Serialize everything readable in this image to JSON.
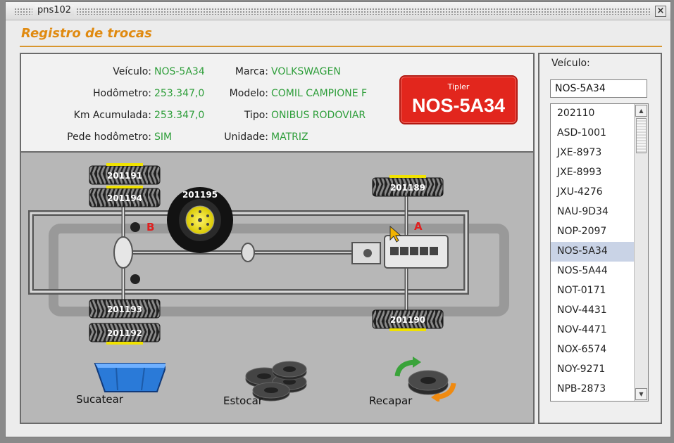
{
  "window": {
    "title": "pns102"
  },
  "section": {
    "title": "Registro de trocas"
  },
  "vehicle_info": {
    "left": [
      {
        "label": "Veículo:",
        "value": "NOS-5A34"
      },
      {
        "label": "Hodômetro:",
        "value": "253.347,0"
      },
      {
        "label": "Km Acumulada:",
        "value": "253.347,0"
      },
      {
        "label": "Pede hodômetro:",
        "value": "SIM"
      }
    ],
    "right": [
      {
        "label": "Marca:",
        "value": "VOLKSWAGEN"
      },
      {
        "label": "Modelo:",
        "value": "COMIL CAMPIONE F"
      },
      {
        "label": "Tipo:",
        "value": "ONIBUS RODOVIAR"
      },
      {
        "label": "Unidade:",
        "value": "MATRIZ"
      }
    ]
  },
  "plate_badge": {
    "caption": "Tipler",
    "plate": "NOS-5A34"
  },
  "diagram": {
    "tires": {
      "left_top_outer": "201191",
      "left_top_inner": "201194",
      "spare": "201195",
      "left_bottom_inner": "201193",
      "left_bottom_outer": "201192",
      "right_top": "201189",
      "right_bottom": "201190"
    },
    "axle_labels": {
      "rear": "B",
      "front": "A"
    },
    "actions": [
      {
        "label": "Sucatear"
      },
      {
        "label": "Estocar"
      },
      {
        "label": "Recapar"
      }
    ]
  },
  "vehicle_selector": {
    "label": "Veículo:",
    "value": "NOS-5A34",
    "items": [
      "202110",
      "ASD-1001",
      "JXE-8973",
      "JXE-8993",
      "JXU-4276",
      "NAU-9D34",
      "NOP-2097",
      "NOS-5A34",
      "NOS-5A44",
      "NOT-0171",
      "NOV-4431",
      "NOV-4471",
      "NOX-6574",
      "NOY-9271",
      "NPB-2873"
    ],
    "selected": "NOS-5A34"
  },
  "colors": {
    "accent": "#e08a10",
    "value_green": "#2e9e3a",
    "badge_red": "#e2261d",
    "selection": "#c9d3e6"
  }
}
